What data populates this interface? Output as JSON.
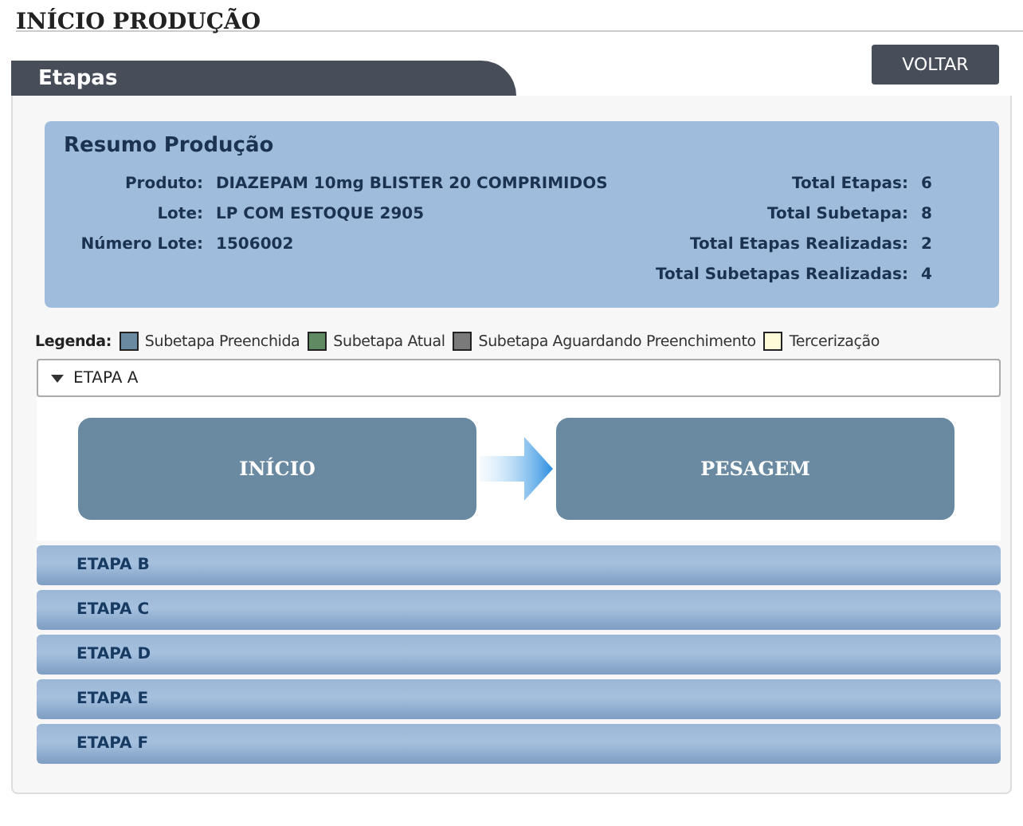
{
  "page": {
    "title": "INÍCIO PRODUÇÃO"
  },
  "tab": {
    "label": "Etapas"
  },
  "back_button": {
    "label": "VOLTAR"
  },
  "summary": {
    "title": "Resumo Produção",
    "left": [
      {
        "label": "Produto:",
        "value": "DIAZEPAM 10mg BLISTER 20 COMPRIMIDOS"
      },
      {
        "label": "Lote:",
        "value": "LP COM ESTOQUE 2905"
      },
      {
        "label": "Número Lote:",
        "value": "1506002"
      }
    ],
    "right": [
      {
        "label": "Total Etapas:",
        "value": "6"
      },
      {
        "label": "Total Subetapa:",
        "value": "8"
      },
      {
        "label": "Total Etapas Realizadas:",
        "value": "2"
      },
      {
        "label": "Total Subetapas Realizadas:",
        "value": "4"
      }
    ]
  },
  "legend": {
    "title": "Legenda:",
    "items": [
      {
        "label": "Subetapa Preenchida",
        "color": "#6a8aa2"
      },
      {
        "label": "Subetapa Atual",
        "color": "#5f8a62"
      },
      {
        "label": "Subetapa Aguardando Preenchimento",
        "color": "#7a7a7a"
      },
      {
        "label": "Tercerização",
        "color": "#fdfbd8"
      }
    ]
  },
  "stages": [
    {
      "label": "ETAPA A",
      "expanded": true,
      "substeps": [
        {
          "label": "INÍCIO",
          "kind": "filled"
        },
        {
          "label": "PESAGEM",
          "kind": "filled"
        }
      ]
    },
    {
      "label": "ETAPA B",
      "expanded": false
    },
    {
      "label": "ETAPA C",
      "expanded": false
    },
    {
      "label": "ETAPA D",
      "expanded": false
    },
    {
      "label": "ETAPA E",
      "expanded": false
    },
    {
      "label": "ETAPA F",
      "expanded": false
    }
  ]
}
